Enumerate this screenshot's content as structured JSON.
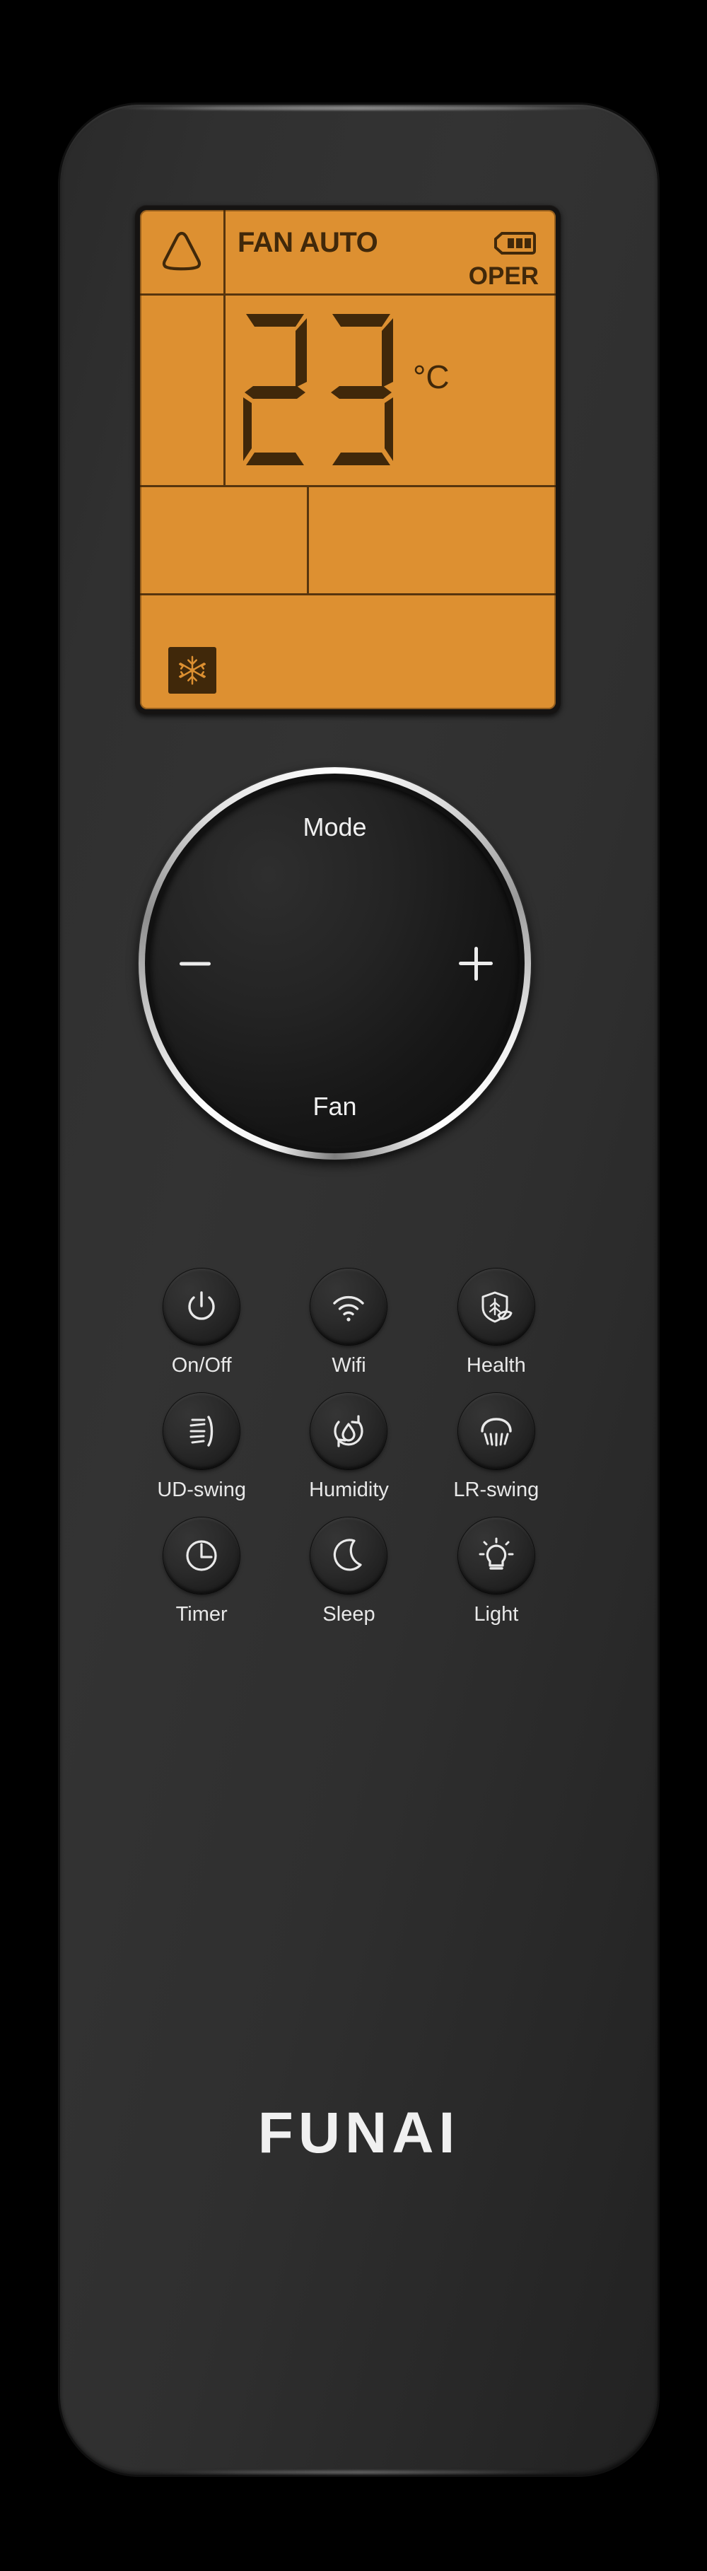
{
  "device": {
    "brand": "FUNAI",
    "type": "air-conditioner-remote-control"
  },
  "lcd": {
    "fan_mode_label": "FAN AUTO",
    "operation_label": "OPER",
    "temperature": "23",
    "temperature_unit": "°C",
    "battery_icon": "battery-full-icon",
    "fan_shape_icon": "rounded-triangle-icon",
    "mode_icon": "snowflake-cool-icon",
    "backlight_color": "#dd9031",
    "segment_color": "#40280a"
  },
  "dial": {
    "top_label": "Mode",
    "bottom_label": "Fan",
    "left_label": "−",
    "right_label": "+",
    "left_icon": "minus-icon",
    "right_icon": "plus-icon",
    "ring_color": "#ffffff"
  },
  "buttons": [
    {
      "label": "On/Off",
      "icon": "power-icon"
    },
    {
      "label": "Wifi",
      "icon": "wifi-icon"
    },
    {
      "label": "Health",
      "icon": "shield-leaf-icon"
    },
    {
      "label": "UD-swing",
      "icon": "up-down-swing-icon"
    },
    {
      "label": "Humidity",
      "icon": "humidity-droplet-icon"
    },
    {
      "label": "LR-swing",
      "icon": "left-right-swing-icon"
    },
    {
      "label": "Timer",
      "icon": "clock-icon"
    },
    {
      "label": "Sleep",
      "icon": "moon-icon"
    },
    {
      "label": "Light",
      "icon": "lightbulb-icon"
    }
  ],
  "colors": {
    "body": "#2f2f2f",
    "background": "#000000",
    "text": "#f0f0f0"
  }
}
